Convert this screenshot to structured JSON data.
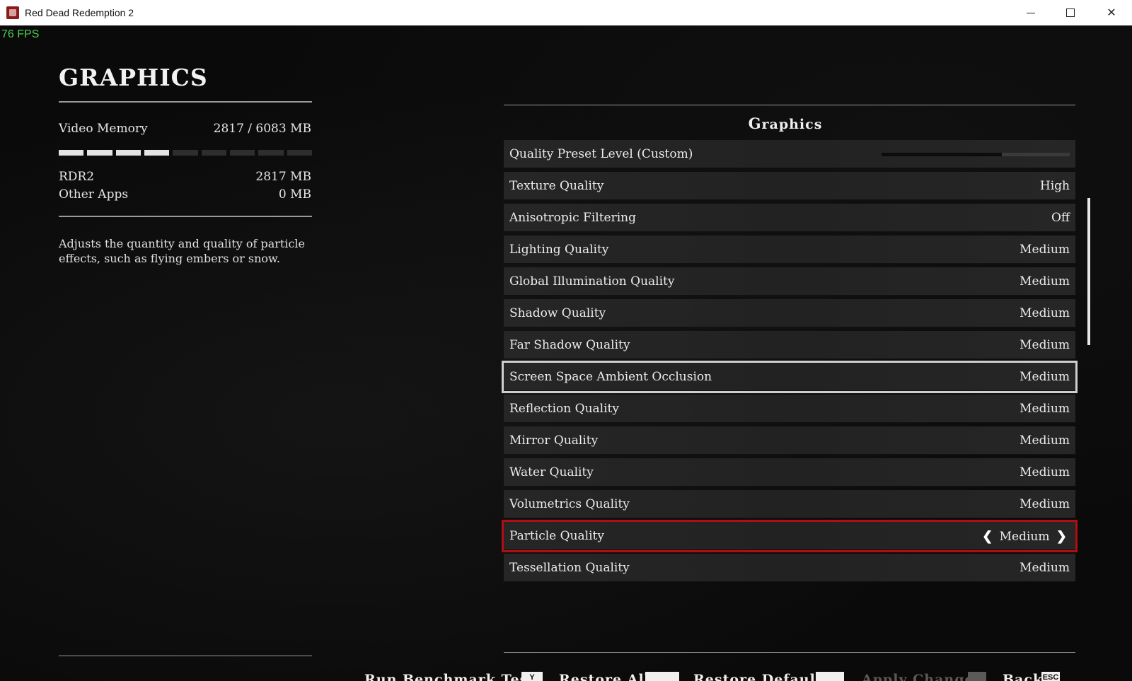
{
  "window": {
    "title": "Red Dead Redemption 2",
    "minimize_icon": "minimize-icon",
    "maximize_icon": "maximize-icon",
    "close_icon": "close-icon"
  },
  "fps": "76 FPS",
  "left_panel": {
    "title": "GRAPHICS",
    "video_memory_label": "Video Memory",
    "video_memory_value": "2817  / 6083  MB",
    "memory_bar": {
      "segments": 9,
      "filled_segments": 4
    },
    "rows": [
      {
        "label": "RDR2",
        "value": "2817  MB"
      },
      {
        "label": "Other Apps",
        "value": "0  MB"
      }
    ],
    "description": "Adjusts the quantity and quality of particle effects, such as flying embers or snow."
  },
  "right_panel": {
    "section_title": "Graphics",
    "preset": {
      "label": "Quality Preset Level (Custom)",
      "fill_fraction": 0.64
    },
    "settings": [
      {
        "label": "Texture Quality",
        "value": "High"
      },
      {
        "label": "Anisotropic Filtering",
        "value": "Off"
      },
      {
        "label": "Lighting Quality",
        "value": "Medium"
      },
      {
        "label": "Global Illumination Quality",
        "value": "Medium"
      },
      {
        "label": "Shadow Quality",
        "value": "Medium"
      },
      {
        "label": "Far Shadow Quality",
        "value": "Medium"
      },
      {
        "label": "Screen Space Ambient Occlusion",
        "value": "Medium"
      },
      {
        "label": "Reflection Quality",
        "value": "Medium"
      },
      {
        "label": "Mirror Quality",
        "value": "Medium"
      },
      {
        "label": "Water Quality",
        "value": "Medium"
      },
      {
        "label": "Volumetrics Quality",
        "value": "Medium"
      },
      {
        "label": "Particle Quality",
        "value": "Medium"
      },
      {
        "label": "Tessellation Quality",
        "value": "Medium"
      }
    ],
    "arrow_left": "❮",
    "arrow_right": "❯"
  },
  "footer": {
    "run_benchmark": "Run Benchmark Tests",
    "run_benchmark_key": "Y",
    "restore_all": "Restore All",
    "restore_default": "Restore Default",
    "apply_changes": "Apply Changes",
    "back": "Back",
    "back_key": "ESC"
  }
}
